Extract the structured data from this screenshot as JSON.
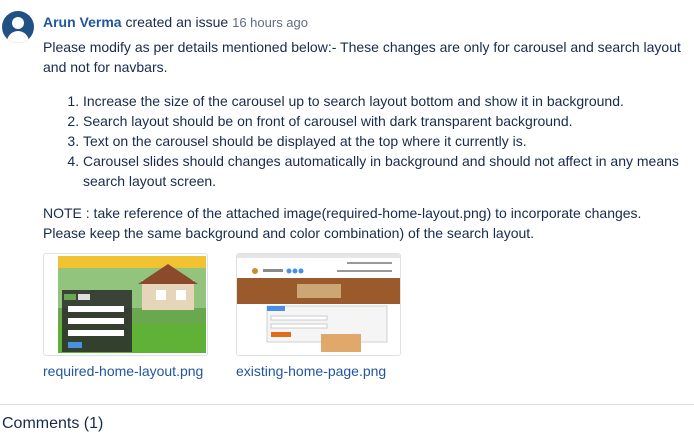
{
  "issue": {
    "author": "Arun Verma",
    "action": "created an issue",
    "time": "16 hours ago"
  },
  "description": {
    "intro": "Please modify as per details mentioned below:- These changes are only for carousel and search layout and not for navbars.",
    "items": [
      "Increase the size of the carousel up to search layout bottom and show it in background.",
      "Search layout should be on front of carousel with dark transparent background.",
      "Text on the carousel should be displayed at the top where it currently is.",
      "Carousel slides should changes automatically in background and should not affect in any means search layout screen."
    ],
    "note": "NOTE : take reference of the attached image(required-home-layout.png) to incorporate changes. Please keep the same background and color combination) of the search layout."
  },
  "attachments": [
    {
      "name": "required-home-layout.png"
    },
    {
      "name": "existing-home-page.png"
    }
  ],
  "comments": {
    "label": "Comments (1)"
  },
  "colors": {
    "link": "#2255a0",
    "text": "#172b4d",
    "muted": "#5e6c84"
  }
}
